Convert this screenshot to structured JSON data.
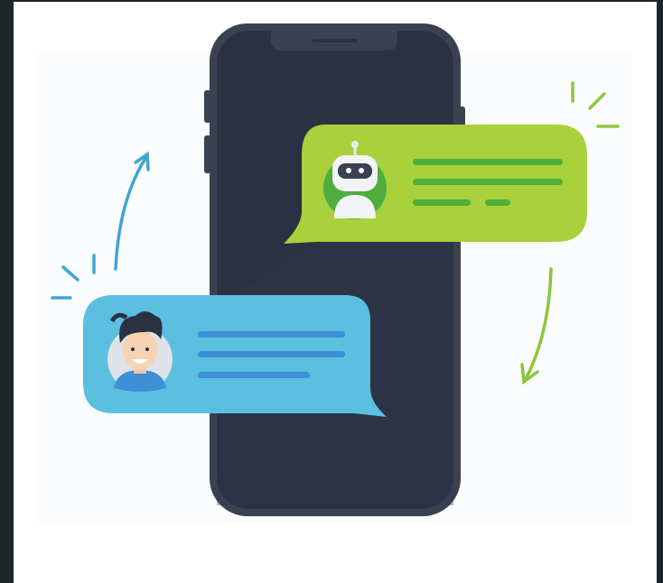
{
  "illustration": {
    "subject": "chat-between-user-and-bot",
    "colors": {
      "background_outer": "#1f252c",
      "canvas": "#ffffff",
      "phone_body": "#3a4150",
      "phone_screen": "#2b3142",
      "bot_bubble": "#a8d13b",
      "bot_lines": "#4fae3d",
      "user_bubble": "#5bbfe0",
      "user_lines": "#3d8fd6",
      "blue_accent": "#3fa6d4",
      "green_accent": "#8cc63f"
    },
    "icons": [
      "robot-avatar-icon",
      "user-avatar-icon",
      "curved-arrow-up-icon",
      "curved-arrow-down-icon"
    ]
  }
}
